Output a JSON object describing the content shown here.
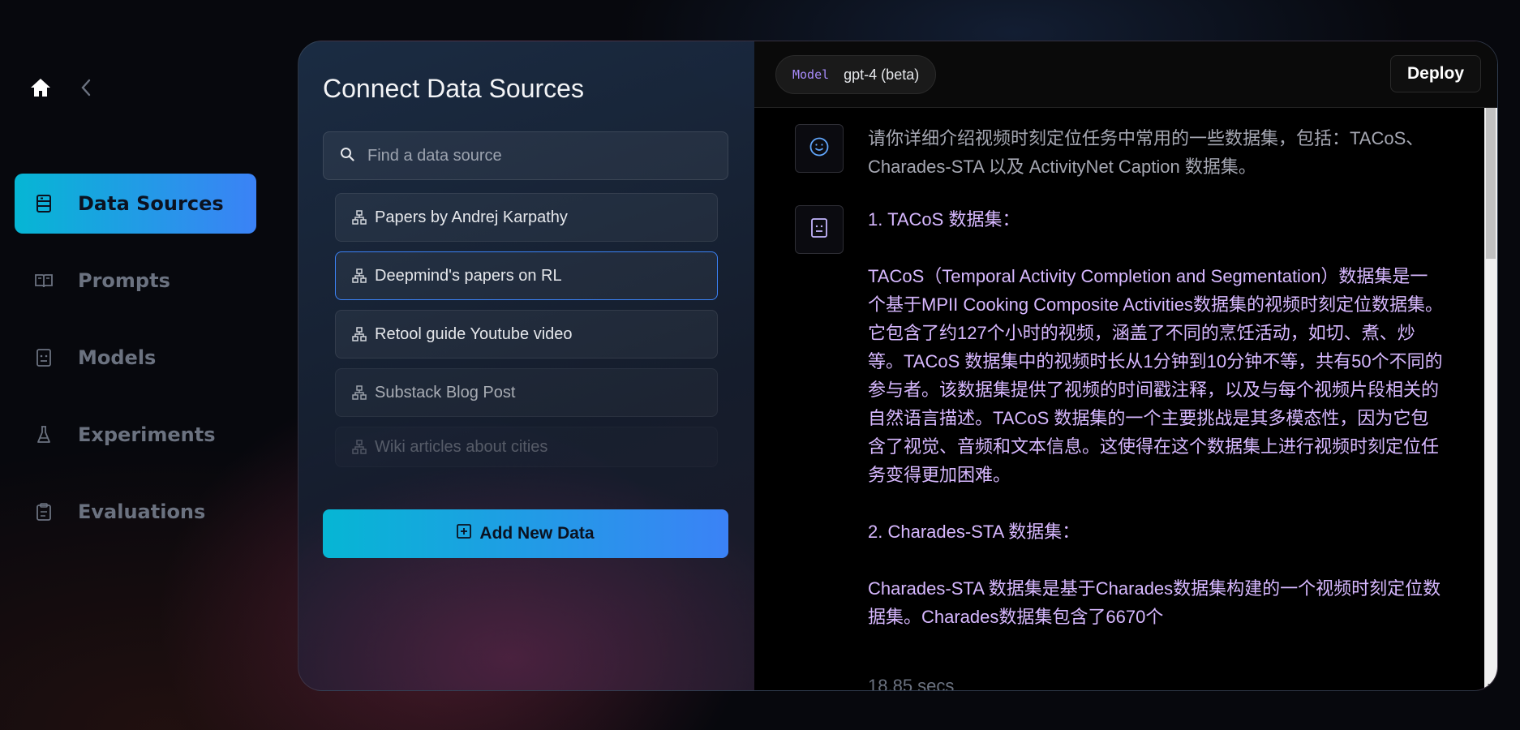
{
  "sidebar": {
    "items": [
      {
        "label": "Data Sources",
        "icon": "database-icon",
        "active": true
      },
      {
        "label": "Prompts",
        "icon": "book-icon",
        "active": false
      },
      {
        "label": "Models",
        "icon": "robot-icon",
        "active": false
      },
      {
        "label": "Experiments",
        "icon": "flask-icon",
        "active": false
      },
      {
        "label": "Evaluations",
        "icon": "clipboard-icon",
        "active": false
      }
    ]
  },
  "connect": {
    "title": "Connect Data Sources",
    "search_placeholder": "Find a data source",
    "sources": [
      {
        "label": "Papers by Andrej Karpathy"
      },
      {
        "label": "Deepmind's papers on RL"
      },
      {
        "label": "Retool guide Youtube video"
      },
      {
        "label": "Substack Blog Post"
      },
      {
        "label": "Wiki articles about cities"
      }
    ],
    "add_label": "Add New Data"
  },
  "chat": {
    "model_tag": "Model",
    "model_value": "gpt-4 (beta)",
    "deploy_label": "Deploy",
    "user_message": "请你详细介绍视频时刻定位任务中常用的一些数据集，包括：TACoS、Charades-STA 以及 ActivityNet Caption 数据集。",
    "bot_message": "1. TACoS 数据集：\n\nTACoS（Temporal Activity Completion and Segmentation）数据集是一个基于MPII Cooking Composite Activities数据集的视频时刻定位数据集。它包含了约127个小时的视频，涵盖了不同的烹饪活动，如切、煮、炒等。TACoS 数据集中的视频时长从1分钟到10分钟不等，共有50个不同的参与者。该数据集提供了视频的时间戳注释，以及与每个视频片段相关的自然语言描述。TACoS 数据集的一个主要挑战是其多模态性，因为它包含了视觉、音频和文本信息。这使得在这个数据集上进行视频时刻定位任务变得更加困难。\n\n2. Charades-STA 数据集：\n\nCharades-STA 数据集是基于Charades数据集构建的一个视频时刻定位数据集。Charades数据集包含了6670个",
    "elapsed": "18.85 secs"
  },
  "colors": {
    "accent_start": "#06b6d4",
    "accent_end": "#3b82f6",
    "bot_text": "#d7b8ff",
    "model_tag": "#a78bfa"
  }
}
